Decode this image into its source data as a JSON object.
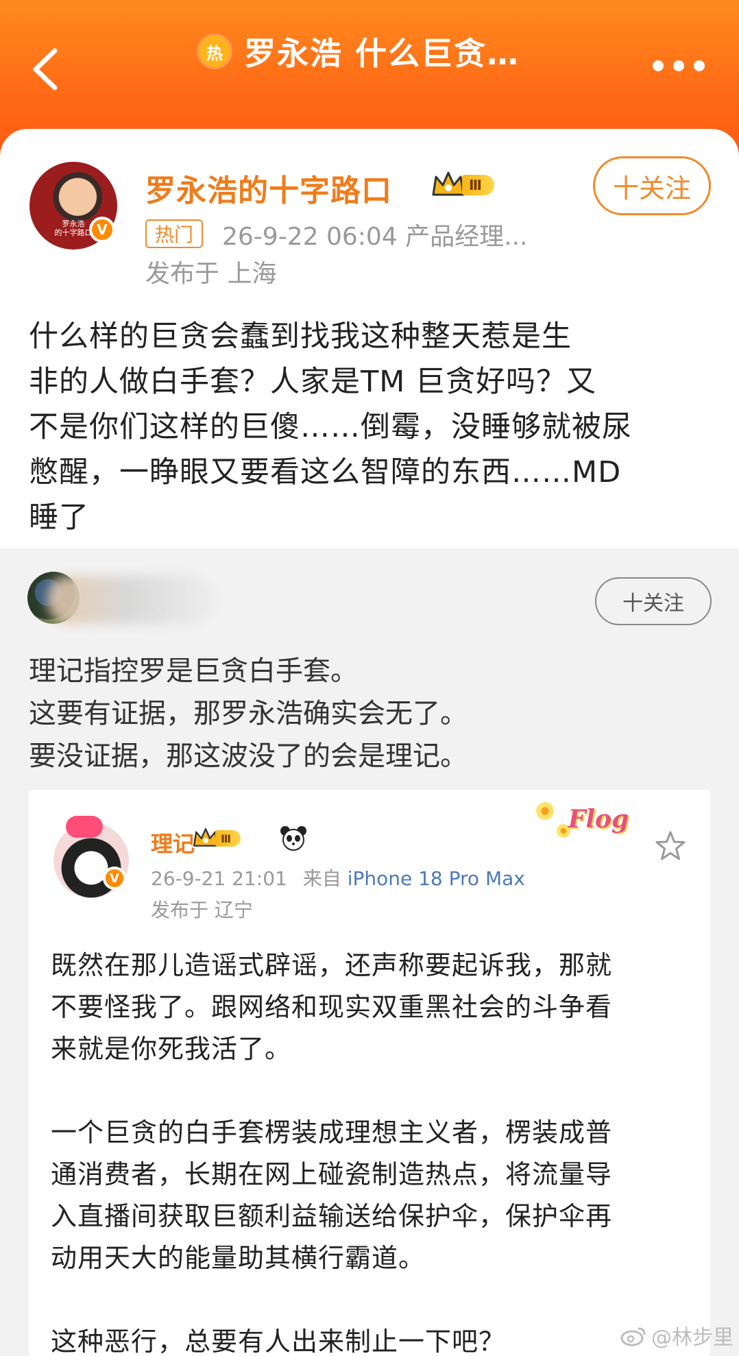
{
  "header": {
    "hot_icon": "热",
    "title": "罗永浩 什么巨贪…",
    "back_icon": "chevron-left-icon",
    "more_icon": "more-horizontal-icon"
  },
  "post": {
    "author": "罗永浩的十字路口",
    "avatar_caption": "罗永浩\n的十字路口",
    "vip_level": "Ⅲ",
    "follow_label": "十关注",
    "hot_tag": "热门",
    "meta": "26-9-22 06:04   产品经理...",
    "location": "发布于 上海",
    "content": "什么样的巨贪会蠢到￼找我这种整天惹是生\n非的人做白手套？￼人家是TM 巨贪好吗？又\n不是你们这样的巨傻……倒霉，没睡够就被尿\n憋醒，一睁眼又要看这么智障的东西……MD\n睡了"
  },
  "repost": {
    "follow_label": "十关注",
    "content": "理记指控罗是巨贪白手套。\n这要有证据，那罗永浩确实会无了。\n要没证据，那这波没了的会是理记。"
  },
  "quoted": {
    "author": "理记",
    "vip_level": "Ⅲ",
    "sticker_text": "Flog",
    "time": "26-9-21 21:01",
    "source_prefix": "来自",
    "device": "iPhone 18 Pro Max",
    "location": "发布于 辽宁",
    "content": "既然在那儿造谣式辟谣，还声称要起诉我，那就\n不要怪我了。跟网络和现实双重黑社会的斗争看\n来就是你死我活了。\n\n一个巨贪的白手套楞装成理想主义者，楞装成普\n通消费者，长期在网上碰瓷制造热点，将流量导\n入直播间获取巨额利益输送给保护伞，保护伞再\n动用天大的能量助其横行霸道。\n\n这种恶行，总要有人出来制止一下吧？"
  },
  "watermark": "@林步里",
  "colors": {
    "header_orange": "#ff6a16",
    "accent": "#f07b1a",
    "link_blue": "#4a7ab8"
  }
}
